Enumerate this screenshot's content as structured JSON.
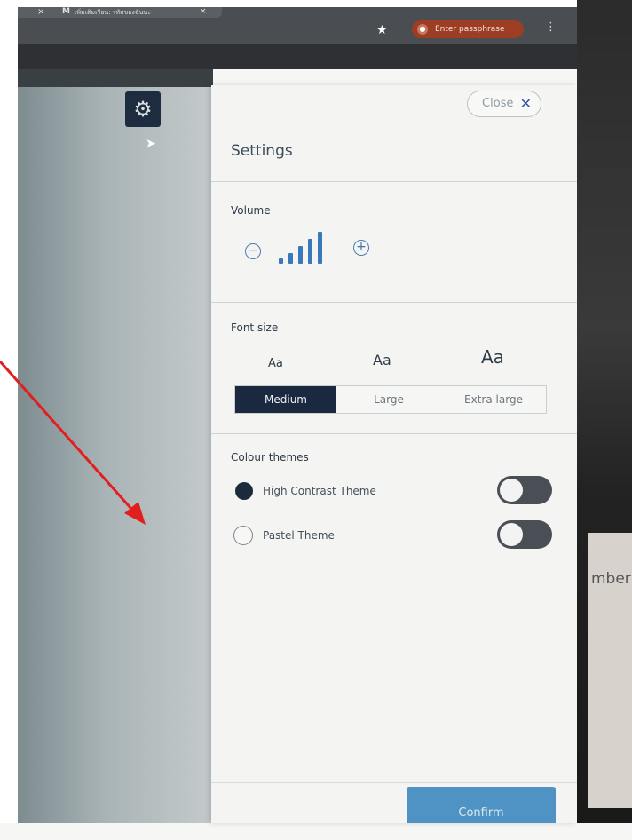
{
  "browser": {
    "tab_title": "เพิ่มเติมเรียน: รหัสของฉันนะ",
    "tab_close_glyph": "×",
    "passphrase_label": "Enter passphrase"
  },
  "settings": {
    "close_label": "Close",
    "title": "Settings",
    "volume": {
      "label": "Volume",
      "level": 5,
      "max": 5
    },
    "font_size": {
      "label": "Font size",
      "sample": "Aa",
      "options": [
        "Medium",
        "Large",
        "Extra large"
      ],
      "selected": "Medium"
    },
    "colour_themes": {
      "label": "Colour themes",
      "items": [
        {
          "name": "High Contrast Theme",
          "selected": true
        },
        {
          "name": "Pastel Theme",
          "selected": false
        }
      ]
    },
    "confirm_label": "Confirm"
  },
  "right_edge_text": "mber",
  "colors": {
    "accent_navy": "#1b2940",
    "volume_blue": "#3a78bd",
    "confirm_blue": "#4e93c4",
    "annotation_red": "#e11f1f",
    "passphrase_bg": "#9c3d24"
  },
  "icons": {
    "settings": "gear-icon",
    "close": "close-icon",
    "volume_down": "minus-circle-icon",
    "volume_up": "plus-circle-icon",
    "star": "star-icon",
    "menu": "kebab-menu-icon"
  }
}
